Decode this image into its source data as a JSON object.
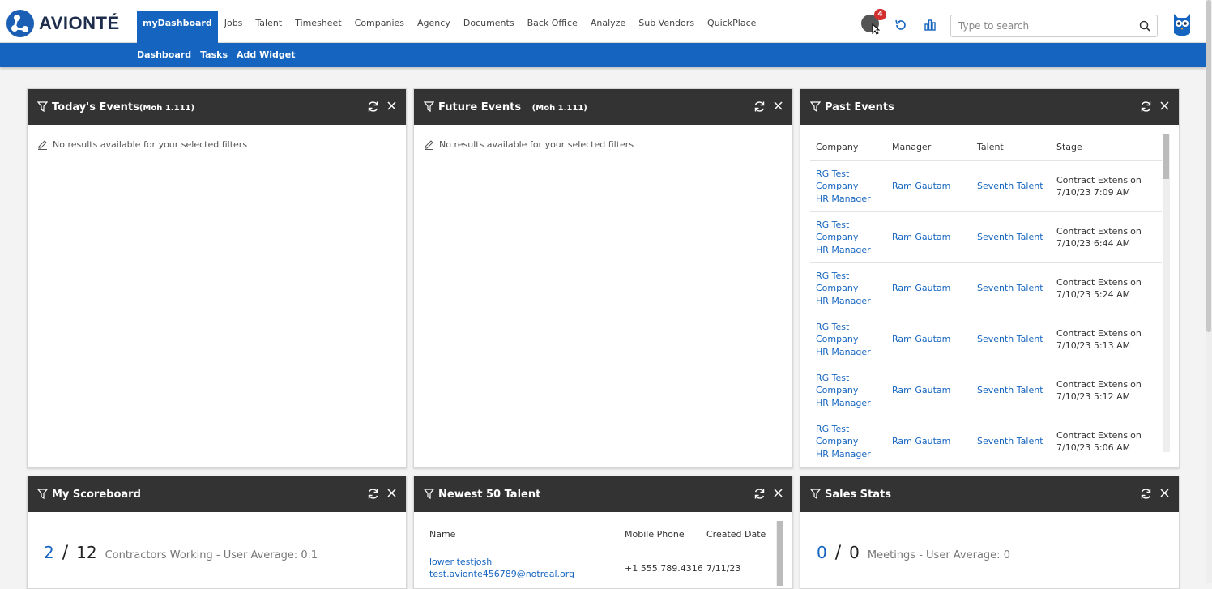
{
  "brand": {
    "name": "AVIONTÉ"
  },
  "nav": {
    "items": [
      "myDashboard",
      "Jobs",
      "Talent",
      "Timesheet",
      "Companies",
      "Agency",
      "Documents",
      "Back Office",
      "Analyze",
      "Sub Vendors",
      "QuickPlace"
    ],
    "active": "myDashboard"
  },
  "notifications": {
    "count": "4"
  },
  "search": {
    "placeholder": "Type to search"
  },
  "subnav": {
    "items": [
      "Dashboard",
      "Tasks",
      "Add Widget"
    ]
  },
  "widgets": {
    "todays_events": {
      "title": "Today's Events",
      "subtitle": "(Moh 1.111)",
      "empty": "No results available for your selected filters"
    },
    "future_events": {
      "title": "Future Events",
      "subtitle": "(Moh 1.111)",
      "empty": "No results available for your selected filters"
    },
    "past_events": {
      "title": "Past Events",
      "columns": [
        "Company",
        "Manager",
        "Talent",
        "Stage"
      ],
      "rows": [
        {
          "company_1": "RG Test",
          "company_2": "Company",
          "company_3": "HR Manager",
          "manager": "Ram Gautam",
          "talent": "Seventh Talent",
          "stage": "Contract Extension",
          "date": "7/10/23 7:09 AM"
        },
        {
          "company_1": "RG Test",
          "company_2": "Company",
          "company_3": "HR Manager",
          "manager": "Ram Gautam",
          "talent": "Seventh Talent",
          "stage": "Contract Extension",
          "date": "7/10/23 6:44 AM"
        },
        {
          "company_1": "RG Test",
          "company_2": "Company",
          "company_3": "HR Manager",
          "manager": "Ram Gautam",
          "talent": "Seventh Talent",
          "stage": "Contract Extension",
          "date": "7/10/23 5:24 AM"
        },
        {
          "company_1": "RG Test",
          "company_2": "Company",
          "company_3": "HR Manager",
          "manager": "Ram Gautam",
          "talent": "Seventh Talent",
          "stage": "Contract Extension",
          "date": "7/10/23 5:13 AM"
        },
        {
          "company_1": "RG Test",
          "company_2": "Company",
          "company_3": "HR Manager",
          "manager": "Ram Gautam",
          "talent": "Seventh Talent",
          "stage": "Contract Extension",
          "date": "7/10/23 5:12 AM"
        },
        {
          "company_1": "RG Test",
          "company_2": "Company",
          "company_3": "HR Manager",
          "manager": "Ram Gautam",
          "talent": "Seventh Talent",
          "stage": "Contract Extension",
          "date": "7/10/23 5:06 AM"
        }
      ]
    },
    "my_scoreboard": {
      "title": "My Scoreboard",
      "value": "2",
      "total": "12",
      "label": "Contractors Working - User Average: 0.1"
    },
    "newest_talent": {
      "title": "Newest 50 Talent",
      "columns": [
        "Name",
        "Mobile Phone",
        "Created Date"
      ],
      "rows": [
        {
          "name": "lower testjosh",
          "email": "test.avionte456789@notreal.org",
          "phone": "+1 555 789.4316",
          "created": "7/11/23"
        }
      ]
    },
    "sales_stats": {
      "title": "Sales Stats",
      "value": "0",
      "total": "0",
      "label": "Meetings - User Average: 0"
    }
  },
  "colors": {
    "brand_blue": "#1565c0",
    "header_dark": "#333333",
    "badge_red": "#d32f2f"
  }
}
